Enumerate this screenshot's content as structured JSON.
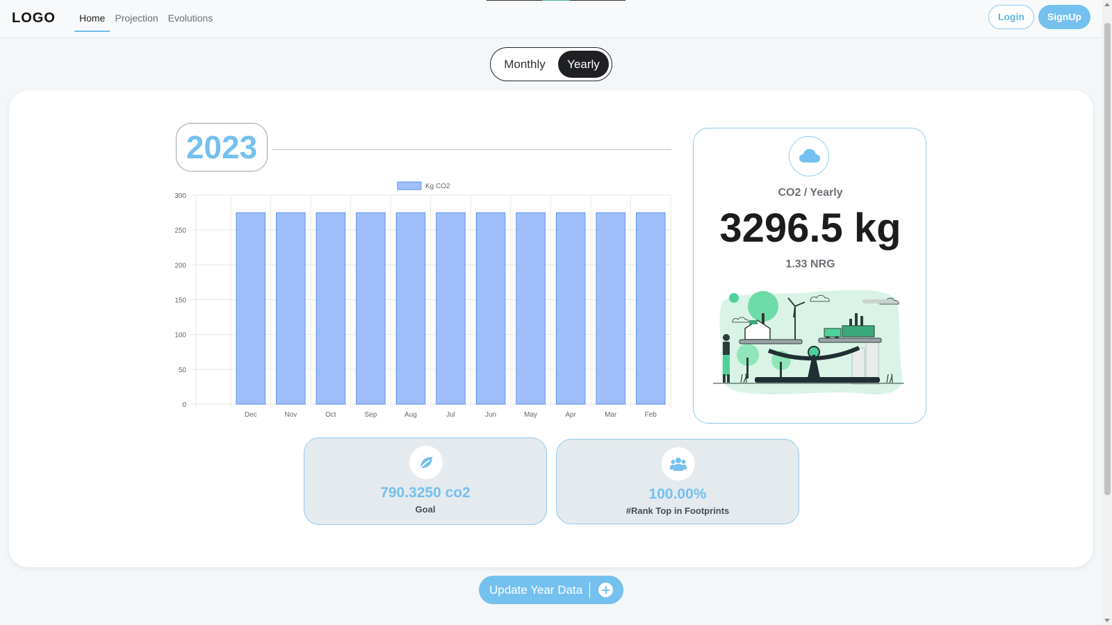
{
  "header": {
    "logo": "LOGO",
    "nav": [
      {
        "label": "Home",
        "active": true
      },
      {
        "label": "Projection",
        "active": false
      },
      {
        "label": "Evolutions",
        "active": false
      }
    ],
    "login_label": "Login",
    "signup_label": "SignUp"
  },
  "toggle": {
    "monthly_label": "Monthly",
    "yearly_label": "Yearly",
    "selected": "Yearly"
  },
  "year": "2023",
  "chart_data": {
    "type": "bar",
    "categories": [
      "Dec",
      "Nov",
      "Oct",
      "Sep",
      "Aug",
      "Jul",
      "Jun",
      "May",
      "Apr",
      "Mar",
      "Feb"
    ],
    "series": [
      {
        "name": "Kg CO2",
        "values": [
          274.7,
          274.7,
          274.7,
          274.7,
          274.7,
          274.7,
          274.7,
          274.7,
          274.7,
          274.7,
          274.7
        ]
      }
    ],
    "yticks": [
      "0",
      "50",
      "100",
      "150",
      "200",
      "250",
      "300"
    ],
    "ylim": [
      0,
      300
    ],
    "grid": true,
    "legend": "top",
    "colors": {
      "bar_fill": "#a0befa",
      "bar_stroke": "#5a8ff0"
    }
  },
  "co2_card": {
    "icon": "cloud-icon",
    "label": "CO2 / Yearly",
    "value": "3296.5 kg",
    "nrg": "1.33 NRG"
  },
  "goal_card": {
    "icon": "leaf-icon",
    "value": "790.3250 co2",
    "label": "Goal"
  },
  "rank_card": {
    "icon": "users-icon",
    "value": "100.00%",
    "label": "#Rank Top in Footprints"
  },
  "update_button": {
    "label": "Update Year Data",
    "icon": "plus-circle-icon"
  },
  "colors": {
    "accent": "#74c0ee",
    "dark": "#1f2023",
    "illustration_green": "#4fd19a"
  }
}
